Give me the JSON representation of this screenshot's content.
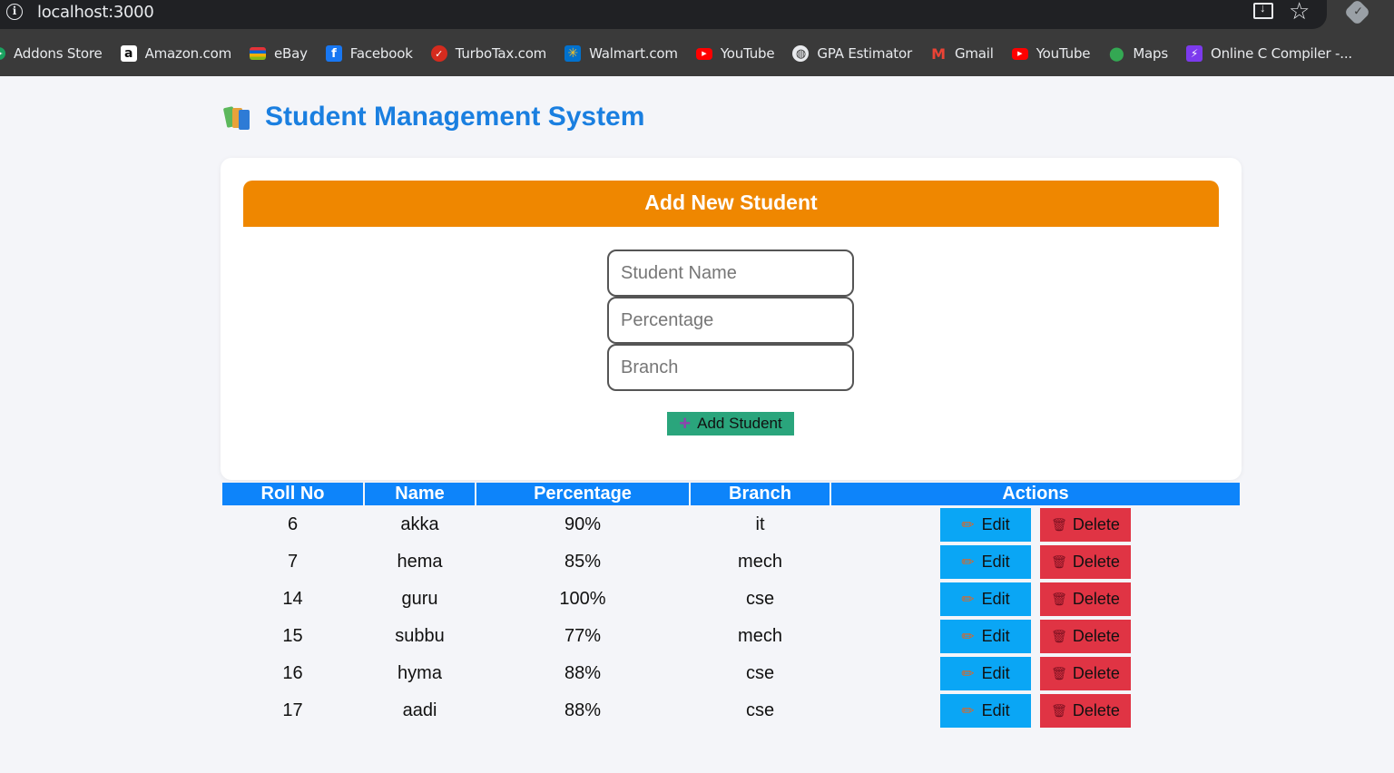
{
  "browser": {
    "url": "localhost:3000",
    "bookmarks": [
      {
        "label": "Addons Store",
        "icon": "addons-store-icon",
        "color": "#1aa260"
      },
      {
        "label": "Amazon.com",
        "icon": "amazon-icon",
        "color": "#ffffff"
      },
      {
        "label": "eBay",
        "icon": "ebay-icon",
        "color": "#e53238"
      },
      {
        "label": "Facebook",
        "icon": "facebook-icon",
        "color": "#1877f2"
      },
      {
        "label": "TurboTax.com",
        "icon": "turbotax-icon",
        "color": "#d52b1e"
      },
      {
        "label": "Walmart.com",
        "icon": "walmart-icon",
        "color": "#0071ce"
      },
      {
        "label": "YouTube",
        "icon": "youtube-icon",
        "color": "#ff0000"
      },
      {
        "label": "GPA Estimator",
        "icon": "globe-icon",
        "color": "#9aa0a6"
      },
      {
        "label": "Gmail",
        "icon": "gmail-icon",
        "color": "#ea4335"
      },
      {
        "label": "YouTube",
        "icon": "youtube-icon",
        "color": "#ff0000"
      },
      {
        "label": "Maps",
        "icon": "maps-icon",
        "color": "#34a853"
      },
      {
        "label": "Online C Compiler -...",
        "icon": "compiler-icon",
        "color": "#7c3aed"
      }
    ]
  },
  "page": {
    "title": "Student Management System",
    "title_color": "#1a7fe0"
  },
  "form": {
    "header": "Add New Student",
    "header_color": "#ef8700",
    "name_placeholder": "Student Name",
    "percentage_placeholder": "Percentage",
    "branch_placeholder": "Branch",
    "submit_label": "Add Student"
  },
  "table": {
    "header_color": "#0d84fa",
    "columns": [
      "Roll No",
      "Name",
      "Percentage",
      "Branch",
      "Actions"
    ],
    "edit_label": "Edit",
    "delete_label": "Delete",
    "rows": [
      {
        "roll": "6",
        "name": "akka",
        "percentage": "90%",
        "branch": "it"
      },
      {
        "roll": "7",
        "name": "hema",
        "percentage": "85%",
        "branch": "mech"
      },
      {
        "roll": "14",
        "name": "guru",
        "percentage": "100%",
        "branch": "cse"
      },
      {
        "roll": "15",
        "name": "subbu",
        "percentage": "77%",
        "branch": "mech"
      },
      {
        "roll": "16",
        "name": "hyma",
        "percentage": "88%",
        "branch": "cse"
      },
      {
        "roll": "17",
        "name": "aadi",
        "percentage": "88%",
        "branch": "cse"
      }
    ]
  }
}
